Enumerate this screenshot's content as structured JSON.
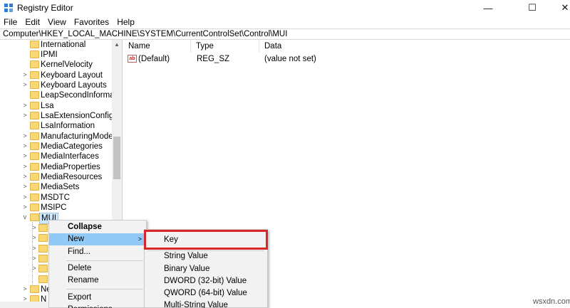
{
  "window": {
    "title": "Registry Editor",
    "controls": {
      "minimize": "—",
      "maximize": "☐",
      "close": "✕"
    }
  },
  "menu": [
    "File",
    "Edit",
    "View",
    "Favorites",
    "Help"
  ],
  "address": "Computer\\HKEY_LOCAL_MACHINE\\SYSTEM\\CurrentControlSet\\Control\\MUI",
  "tree": {
    "items": [
      {
        "label": "International",
        "expandable": false
      },
      {
        "label": "IPMI",
        "expandable": false
      },
      {
        "label": "KernelVelocity",
        "expandable": false
      },
      {
        "label": "Keyboard Layout",
        "expandable": true
      },
      {
        "label": "Keyboard Layouts",
        "expandable": true
      },
      {
        "label": "LeapSecondInformation",
        "expandable": false
      },
      {
        "label": "Lsa",
        "expandable": true
      },
      {
        "label": "LsaExtensionConfig",
        "expandable": true
      },
      {
        "label": "LsaInformation",
        "expandable": false
      },
      {
        "label": "ManufacturingMode",
        "expandable": true
      },
      {
        "label": "MediaCategories",
        "expandable": true
      },
      {
        "label": "MediaInterfaces",
        "expandable": true
      },
      {
        "label": "MediaProperties",
        "expandable": true
      },
      {
        "label": "MediaResources",
        "expandable": true
      },
      {
        "label": "MediaSets",
        "expandable": true
      },
      {
        "label": "MSDTC",
        "expandable": true
      },
      {
        "label": "MSIPC",
        "expandable": true
      },
      {
        "label": "MUI",
        "expandable": true,
        "expanded": true,
        "selected": true
      }
    ],
    "after_items": [
      {
        "label": "Ne"
      },
      {
        "label": "N"
      }
    ]
  },
  "list": {
    "headers": {
      "name": "Name",
      "type": "Type",
      "data": "Data"
    },
    "rows": [
      {
        "name": "(Default)",
        "type": "REG_SZ",
        "data": "(value not set)",
        "icon": "ab"
      }
    ]
  },
  "context_menu": {
    "items": [
      {
        "label": "Collapse",
        "bold": true
      },
      {
        "label": "New",
        "submenu": true,
        "hover": true
      },
      {
        "label": "Find..."
      },
      {
        "label": "Delete"
      },
      {
        "label": "Rename"
      },
      {
        "label": "Export"
      },
      {
        "label": "Permissions..."
      }
    ]
  },
  "submenu": {
    "items": [
      {
        "label": "Key"
      },
      {
        "label": "String Value"
      },
      {
        "label": "Binary Value"
      },
      {
        "label": "DWORD (32-bit) Value"
      },
      {
        "label": "QWORD (64-bit) Value"
      },
      {
        "label": "Multi-String Value"
      }
    ]
  },
  "watermark": "wsxdn.com",
  "colors": {
    "highlight_border": "#d9262a",
    "menu_hover": "#91c9f7",
    "folder": "#f8d775"
  }
}
